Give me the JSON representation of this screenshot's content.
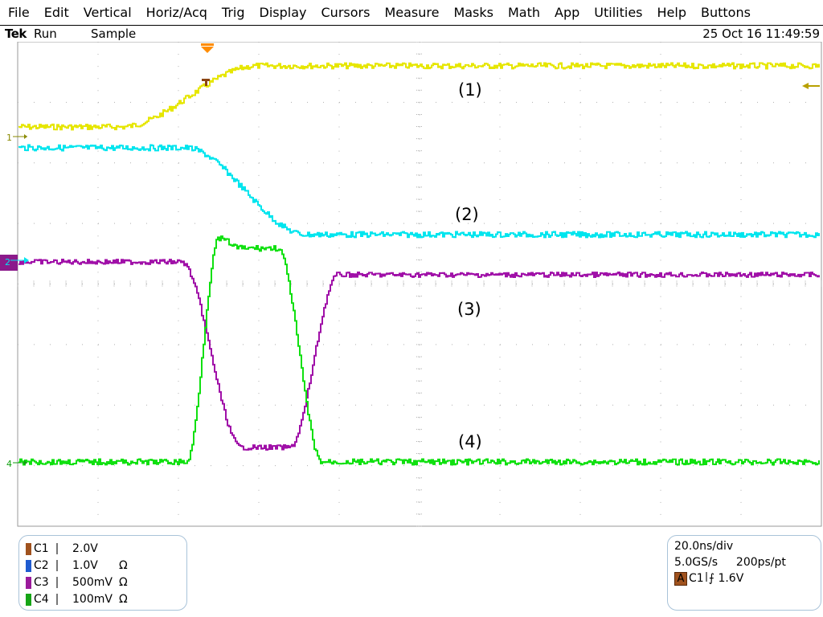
{
  "menu": [
    "File",
    "Edit",
    "Vertical",
    "Horiz/Acq",
    "Trig",
    "Display",
    "Cursors",
    "Measure",
    "Masks",
    "Math",
    "App",
    "Utilities",
    "Help",
    "Buttons"
  ],
  "status": {
    "brand": "Tek",
    "run_state": "Run",
    "acq_mode": "Sample",
    "datetime": "25 Oct 16 11:49:59"
  },
  "waveform_labels": [
    "(1)",
    "(2)",
    "(3)",
    "(4)"
  ],
  "channel_markers": [
    "1",
    "2",
    "4"
  ],
  "channels": [
    {
      "name": "C1",
      "scale": "2.0V",
      "coupling": "",
      "color": "#a0521e"
    },
    {
      "name": "C2",
      "scale": "1.0V",
      "coupling": "Ω",
      "color": "#1f5bd0"
    },
    {
      "name": "C3",
      "scale": "500mV",
      "coupling": "Ω",
      "color": "#9b1a9b"
    },
    {
      "name": "C4",
      "scale": "100mV",
      "coupling": "Ω",
      "color": "#16a516"
    }
  ],
  "horizontal": {
    "timebase": "20.0ns/div",
    "sample_rate": "5.0GS/s",
    "resolution": "200ps/pt",
    "trigger_badge": "A",
    "trigger_source": "C1",
    "trigger_slope": "⨍",
    "trigger_level": "1.6V"
  },
  "trace_colors": {
    "ch1": "#e6e600",
    "ch2": "#00e5ee",
    "ch3": "#a010a8",
    "ch4": "#10e010",
    "trigger_marker": "#ff8c00"
  }
}
